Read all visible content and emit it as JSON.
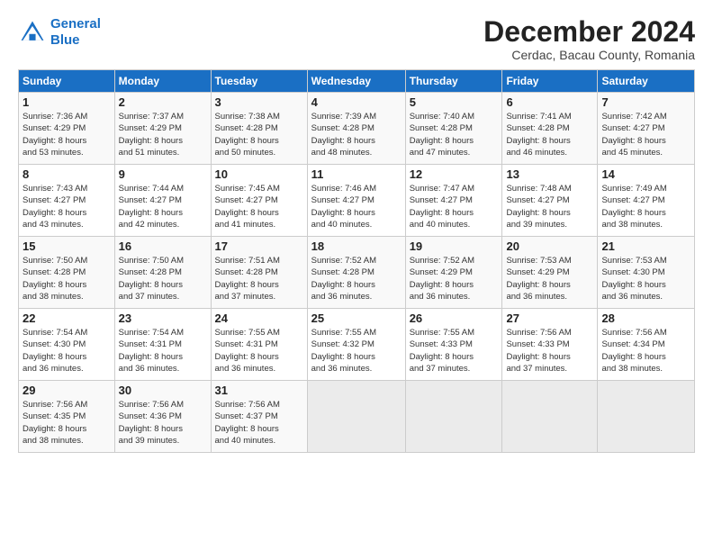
{
  "header": {
    "logo_line1": "General",
    "logo_line2": "Blue",
    "title": "December 2024",
    "subtitle": "Cerdac, Bacau County, Romania"
  },
  "weekdays": [
    "Sunday",
    "Monday",
    "Tuesday",
    "Wednesday",
    "Thursday",
    "Friday",
    "Saturday"
  ],
  "weeks": [
    [
      {
        "day": "1",
        "info": "Sunrise: 7:36 AM\nSunset: 4:29 PM\nDaylight: 8 hours\nand 53 minutes."
      },
      {
        "day": "2",
        "info": "Sunrise: 7:37 AM\nSunset: 4:29 PM\nDaylight: 8 hours\nand 51 minutes."
      },
      {
        "day": "3",
        "info": "Sunrise: 7:38 AM\nSunset: 4:28 PM\nDaylight: 8 hours\nand 50 minutes."
      },
      {
        "day": "4",
        "info": "Sunrise: 7:39 AM\nSunset: 4:28 PM\nDaylight: 8 hours\nand 48 minutes."
      },
      {
        "day": "5",
        "info": "Sunrise: 7:40 AM\nSunset: 4:28 PM\nDaylight: 8 hours\nand 47 minutes."
      },
      {
        "day": "6",
        "info": "Sunrise: 7:41 AM\nSunset: 4:28 PM\nDaylight: 8 hours\nand 46 minutes."
      },
      {
        "day": "7",
        "info": "Sunrise: 7:42 AM\nSunset: 4:27 PM\nDaylight: 8 hours\nand 45 minutes."
      }
    ],
    [
      {
        "day": "8",
        "info": "Sunrise: 7:43 AM\nSunset: 4:27 PM\nDaylight: 8 hours\nand 43 minutes."
      },
      {
        "day": "9",
        "info": "Sunrise: 7:44 AM\nSunset: 4:27 PM\nDaylight: 8 hours\nand 42 minutes."
      },
      {
        "day": "10",
        "info": "Sunrise: 7:45 AM\nSunset: 4:27 PM\nDaylight: 8 hours\nand 41 minutes."
      },
      {
        "day": "11",
        "info": "Sunrise: 7:46 AM\nSunset: 4:27 PM\nDaylight: 8 hours\nand 40 minutes."
      },
      {
        "day": "12",
        "info": "Sunrise: 7:47 AM\nSunset: 4:27 PM\nDaylight: 8 hours\nand 40 minutes."
      },
      {
        "day": "13",
        "info": "Sunrise: 7:48 AM\nSunset: 4:27 PM\nDaylight: 8 hours\nand 39 minutes."
      },
      {
        "day": "14",
        "info": "Sunrise: 7:49 AM\nSunset: 4:27 PM\nDaylight: 8 hours\nand 38 minutes."
      }
    ],
    [
      {
        "day": "15",
        "info": "Sunrise: 7:50 AM\nSunset: 4:28 PM\nDaylight: 8 hours\nand 38 minutes."
      },
      {
        "day": "16",
        "info": "Sunrise: 7:50 AM\nSunset: 4:28 PM\nDaylight: 8 hours\nand 37 minutes."
      },
      {
        "day": "17",
        "info": "Sunrise: 7:51 AM\nSunset: 4:28 PM\nDaylight: 8 hours\nand 37 minutes."
      },
      {
        "day": "18",
        "info": "Sunrise: 7:52 AM\nSunset: 4:28 PM\nDaylight: 8 hours\nand 36 minutes."
      },
      {
        "day": "19",
        "info": "Sunrise: 7:52 AM\nSunset: 4:29 PM\nDaylight: 8 hours\nand 36 minutes."
      },
      {
        "day": "20",
        "info": "Sunrise: 7:53 AM\nSunset: 4:29 PM\nDaylight: 8 hours\nand 36 minutes."
      },
      {
        "day": "21",
        "info": "Sunrise: 7:53 AM\nSunset: 4:30 PM\nDaylight: 8 hours\nand 36 minutes."
      }
    ],
    [
      {
        "day": "22",
        "info": "Sunrise: 7:54 AM\nSunset: 4:30 PM\nDaylight: 8 hours\nand 36 minutes."
      },
      {
        "day": "23",
        "info": "Sunrise: 7:54 AM\nSunset: 4:31 PM\nDaylight: 8 hours\nand 36 minutes."
      },
      {
        "day": "24",
        "info": "Sunrise: 7:55 AM\nSunset: 4:31 PM\nDaylight: 8 hours\nand 36 minutes."
      },
      {
        "day": "25",
        "info": "Sunrise: 7:55 AM\nSunset: 4:32 PM\nDaylight: 8 hours\nand 36 minutes."
      },
      {
        "day": "26",
        "info": "Sunrise: 7:55 AM\nSunset: 4:33 PM\nDaylight: 8 hours\nand 37 minutes."
      },
      {
        "day": "27",
        "info": "Sunrise: 7:56 AM\nSunset: 4:33 PM\nDaylight: 8 hours\nand 37 minutes."
      },
      {
        "day": "28",
        "info": "Sunrise: 7:56 AM\nSunset: 4:34 PM\nDaylight: 8 hours\nand 38 minutes."
      }
    ],
    [
      {
        "day": "29",
        "info": "Sunrise: 7:56 AM\nSunset: 4:35 PM\nDaylight: 8 hours\nand 38 minutes."
      },
      {
        "day": "30",
        "info": "Sunrise: 7:56 AM\nSunset: 4:36 PM\nDaylight: 8 hours\nand 39 minutes."
      },
      {
        "day": "31",
        "info": "Sunrise: 7:56 AM\nSunset: 4:37 PM\nDaylight: 8 hours\nand 40 minutes."
      },
      {
        "day": "",
        "info": ""
      },
      {
        "day": "",
        "info": ""
      },
      {
        "day": "",
        "info": ""
      },
      {
        "day": "",
        "info": ""
      }
    ]
  ]
}
